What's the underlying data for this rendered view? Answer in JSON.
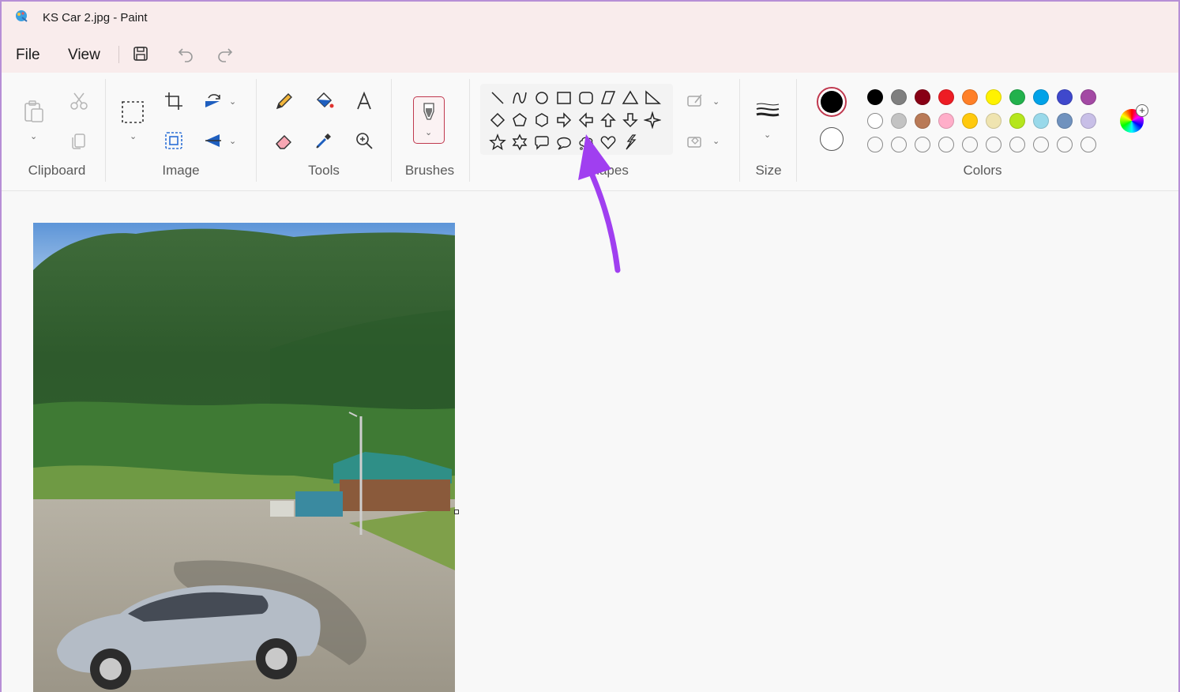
{
  "window": {
    "title": "KS Car 2.jpg - Paint",
    "app_icon": "paint-app-icon"
  },
  "menu": {
    "file": "File",
    "view": "View",
    "quick_icons": [
      "save-icon",
      "undo-icon",
      "redo-icon"
    ]
  },
  "ribbon": {
    "groups": {
      "clipboard": "Clipboard",
      "image": "Image",
      "tools": "Tools",
      "brushes": "Brushes",
      "shapes": "Shapes",
      "size": "Size",
      "colors": "Colors"
    },
    "clipboard_icons": [
      "paste-icon",
      "cut-icon",
      "copy-icon"
    ],
    "image_icons": [
      "select-icon",
      "crop-icon",
      "resize-icon",
      "rotate-icon",
      "flip-icon"
    ],
    "tool_icons": [
      "pencil-icon",
      "fill-icon",
      "text-icon",
      "eraser-icon",
      "color-picker-icon",
      "magnifier-icon"
    ],
    "shape_icons": [
      "line-icon",
      "curve-icon",
      "oval-icon",
      "rectangle-icon",
      "rounded-rectangle-icon",
      "polygon-icon",
      "triangle-icon",
      "right-triangle-icon",
      "diamond-icon",
      "pentagon-icon",
      "hexagon-icon",
      "right-arrow-icon",
      "left-arrow-icon",
      "up-arrow-icon",
      "down-arrow-icon",
      "four-point-star-icon",
      "five-point-star-icon",
      "six-point-star-icon",
      "rounded-callout-icon",
      "oval-callout-icon",
      "cloud-callout-icon",
      "heart-icon",
      "lightning-icon"
    ],
    "outline_icon": "shape-outline-icon",
    "fill_icon": "shape-fill-icon",
    "size_icon": "stroke-size-icon"
  },
  "colors": {
    "primary": "#000000",
    "secondary": "#ffffff",
    "accent": "#c0394f",
    "row1": [
      "#000000",
      "#7f7f7f",
      "#880015",
      "#ed1c24",
      "#ff7f27",
      "#fff200",
      "#22b14c",
      "#00a2e8",
      "#3f48cc",
      "#a349a4"
    ],
    "row2": [
      "#ffffff",
      "#c3c3c3",
      "#b97a57",
      "#ffaec9",
      "#ffc90e",
      "#efe4b0",
      "#b5e61d",
      "#99d9ea",
      "#7092be",
      "#c8bfe7"
    ],
    "row3_empty_count": 10
  },
  "annotation": {
    "arrow_color": "#a03ff0"
  },
  "canvas": {
    "image_description_icon": "photo-canvas"
  }
}
